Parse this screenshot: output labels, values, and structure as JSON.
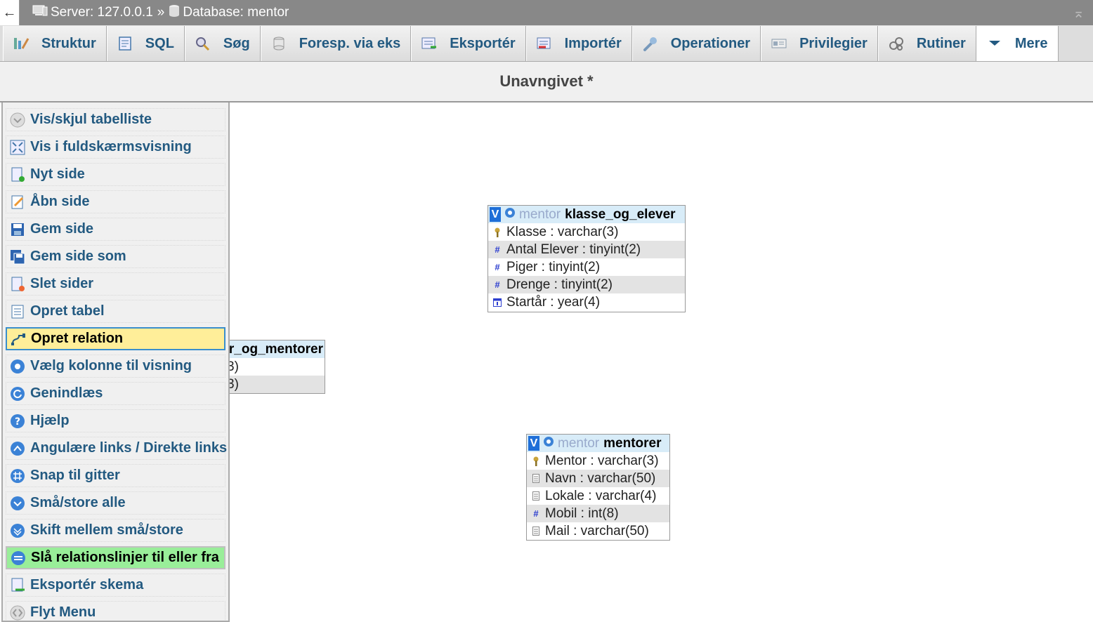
{
  "breadcrumb": {
    "server": "Server: 127.0.0.1",
    "separator": "»",
    "database": "Database: mentor"
  },
  "tabs": [
    {
      "label": "Struktur",
      "icon": "structure-icon"
    },
    {
      "label": "SQL",
      "icon": "sql-icon"
    },
    {
      "label": "Søg",
      "icon": "search-icon"
    },
    {
      "label": "Foresp. via eks",
      "icon": "query-icon"
    },
    {
      "label": "Eksportér",
      "icon": "export-icon"
    },
    {
      "label": "Importér",
      "icon": "import-icon"
    },
    {
      "label": "Operationer",
      "icon": "wrench-icon"
    },
    {
      "label": "Privilegier",
      "icon": "privileges-icon"
    },
    {
      "label": "Rutiner",
      "icon": "routines-icon"
    },
    {
      "label": "Mere",
      "icon": "chevron-down-icon"
    }
  ],
  "page_title": "Unavngivet *",
  "menu": {
    "items": [
      {
        "label": "Vis/skjul tabelliste",
        "icon": "toggle-icon",
        "state": "normal"
      },
      {
        "label": "Vis i fuldskærmsvisning",
        "icon": "fullscreen-icon",
        "state": "normal"
      },
      {
        "label": "Nyt side",
        "icon": "new-page-icon",
        "state": "normal"
      },
      {
        "label": "Åbn side",
        "icon": "open-page-icon",
        "state": "normal"
      },
      {
        "label": "Gem side",
        "icon": "save-icon",
        "state": "normal"
      },
      {
        "label": "Gem side som",
        "icon": "save-as-icon",
        "state": "normal"
      },
      {
        "label": "Slet sider",
        "icon": "delete-page-icon",
        "state": "normal"
      },
      {
        "label": "Opret tabel",
        "icon": "create-table-icon",
        "state": "normal"
      },
      {
        "label": "Opret relation",
        "icon": "relation-icon",
        "state": "yellow"
      },
      {
        "label": "Vælg kolonne til visning",
        "icon": "column-select-icon",
        "state": "normal"
      },
      {
        "label": "Genindlæs",
        "icon": "reload-icon",
        "state": "normal"
      },
      {
        "label": "Hjælp",
        "icon": "help-icon",
        "state": "normal"
      },
      {
        "label": "Angulære links / Direkte links",
        "icon": "angular-links-icon",
        "state": "normal"
      },
      {
        "label": "Snap til gitter",
        "icon": "grid-icon",
        "state": "normal"
      },
      {
        "label": "Små/store alle",
        "icon": "collapse-all-icon",
        "state": "normal"
      },
      {
        "label": "Skift mellem små/store",
        "icon": "toggle-size-icon",
        "state": "normal"
      },
      {
        "label": "Slå relationslinjer til eller fra",
        "icon": "relation-lines-icon",
        "state": "green"
      },
      {
        "label": "Eksportér skema",
        "icon": "export-schema-icon",
        "state": "normal"
      },
      {
        "label": "Flyt Menu",
        "icon": "move-menu-icon",
        "state": "normal"
      }
    ]
  },
  "tables": {
    "klasse": {
      "db": "mentor",
      "name": "klasse_og_elever",
      "columns": [
        {
          "text": "Klasse : varchar(3)",
          "icon": "primary-key-icon"
        },
        {
          "text": "Antal Elever : tinyint(2)",
          "icon": "numeric-icon"
        },
        {
          "text": "Piger : tinyint(2)",
          "icon": "numeric-icon"
        },
        {
          "text": "Drenge : tinyint(2)",
          "icon": "numeric-icon"
        },
        {
          "text": "Startår : year(4)",
          "icon": "date-icon"
        }
      ]
    },
    "partial": {
      "name": "r_og_mentorer",
      "rows": [
        "3)",
        "3)"
      ]
    },
    "mentorer": {
      "db": "mentor",
      "name": "mentorer",
      "columns": [
        {
          "text": "Mentor : varchar(3)",
          "icon": "primary-key-icon"
        },
        {
          "text": "Navn : varchar(50)",
          "icon": "text-icon"
        },
        {
          "text": "Lokale : varchar(4)",
          "icon": "text-icon"
        },
        {
          "text": "Mobil : int(8)",
          "icon": "numeric-icon"
        },
        {
          "text": "Mail : varchar(50)",
          "icon": "text-icon"
        }
      ]
    }
  },
  "toggle_label": "V",
  "colors": {
    "link": "#235a81",
    "highlight_yellow": "#ffee99",
    "highlight_green": "#99ee99",
    "table_header": "#d8ecf8"
  }
}
